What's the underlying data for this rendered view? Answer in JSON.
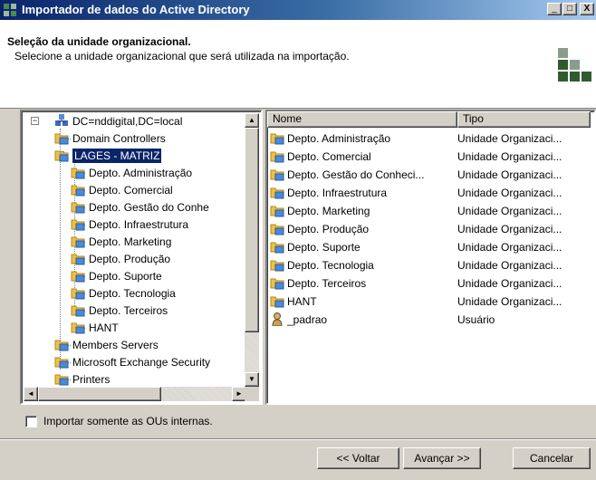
{
  "window": {
    "title": "Importador de dados do Active Directory",
    "minimize_label": "_",
    "maximize_label": "□",
    "close_label": "X"
  },
  "header": {
    "title": "Seleção da unidade organizacional.",
    "subtitle": "Selecione a unidade organizacional que será utilizada na importação."
  },
  "tree": {
    "root": {
      "label": "DC=nddigital,DC=local",
      "expander": "−"
    },
    "items": [
      {
        "label": "Domain Controllers"
      },
      {
        "label": "LAGES - MATRIZ",
        "selected": true,
        "expander": "−"
      },
      {
        "label": "Depto. Administração"
      },
      {
        "label": "Depto. Comercial"
      },
      {
        "label": "Depto. Gestão do Conhe"
      },
      {
        "label": "Depto. Infraestrutura"
      },
      {
        "label": "Depto. Marketing"
      },
      {
        "label": "Depto. Produção"
      },
      {
        "label": "Depto. Suporte"
      },
      {
        "label": "Depto. Tecnologia"
      },
      {
        "label": "Depto. Terceiros"
      },
      {
        "label": "HANT"
      },
      {
        "label": "Members Servers"
      },
      {
        "label": "Microsoft Exchange Security"
      },
      {
        "label": "Printers"
      }
    ],
    "scroll_up": "▲",
    "scroll_down": "▼",
    "scroll_left": "◄",
    "scroll_right": "►"
  },
  "list": {
    "columns": [
      "Nome",
      "Tipo"
    ],
    "rows": [
      {
        "name": "Depto. Administração",
        "type": "Unidade Organizaci...",
        "icon": "ou-folder-icon"
      },
      {
        "name": "Depto. Comercial",
        "type": "Unidade Organizaci...",
        "icon": "ou-folder-icon"
      },
      {
        "name": "Depto. Gestão do Conheci...",
        "type": "Unidade Organizaci...",
        "icon": "ou-folder-icon"
      },
      {
        "name": "Depto. Infraestrutura",
        "type": "Unidade Organizaci...",
        "icon": "ou-folder-icon"
      },
      {
        "name": "Depto. Marketing",
        "type": "Unidade Organizaci...",
        "icon": "ou-folder-icon"
      },
      {
        "name": "Depto. Produção",
        "type": "Unidade Organizaci...",
        "icon": "ou-folder-icon"
      },
      {
        "name": "Depto. Suporte",
        "type": "Unidade Organizaci...",
        "icon": "ou-folder-icon"
      },
      {
        "name": "Depto. Tecnologia",
        "type": "Unidade Organizaci...",
        "icon": "ou-folder-icon"
      },
      {
        "name": "Depto. Terceiros",
        "type": "Unidade Organizaci...",
        "icon": "ou-folder-icon"
      },
      {
        "name": "HANT",
        "type": "Unidade Organizaci...",
        "icon": "ou-folder-icon"
      },
      {
        "name": "_padrao",
        "type": "Usuário",
        "icon": "user-icon"
      }
    ]
  },
  "options": {
    "internal_ous_only": {
      "label": "Importar somente as OUs internas.",
      "checked": false
    }
  },
  "buttons": {
    "back": "<< Voltar",
    "next": "Avançar >>",
    "cancel": "Cancelar"
  },
  "colors": {
    "title_bar": "#0a246a",
    "selection": "#0a246a",
    "logo_dark": "#2f5b2f",
    "logo_light": "#8c9c8c",
    "folder": "#f0c040"
  }
}
